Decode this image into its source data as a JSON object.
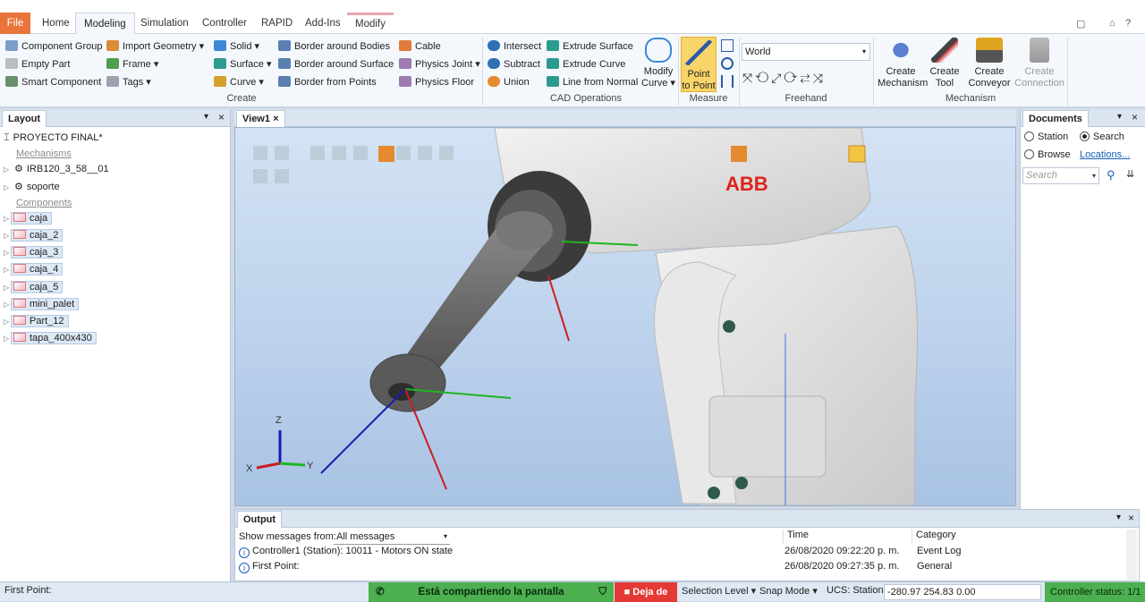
{
  "tabs": [
    "File",
    "Home",
    "Modeling",
    "Simulation",
    "Controller",
    "RAPID",
    "Add-Ins",
    "Modify"
  ],
  "ribbon": {
    "create": [
      "Component Group",
      "Empty Part",
      "Smart Component",
      "Import Geometry",
      "Frame",
      "Tags",
      "Solid",
      "Surface",
      "Curve",
      "Border around Bodies",
      "Border around Surface",
      "Border from Points",
      "Cable",
      "Physics Joint",
      "Physics Floor"
    ],
    "create_label": "Create",
    "cad": [
      "Intersect",
      "Subtract",
      "Union",
      "Extrude Surface",
      "Extrude Curve",
      "Line from Normal"
    ],
    "modify_curve": [
      "Modify",
      "Curve"
    ],
    "cad_label": "CAD Operations",
    "point_to_point": [
      "Point",
      "to Point"
    ],
    "measure_label": "Measure",
    "world": "World",
    "freehand_label": "Freehand",
    "mech": [
      [
        "Create",
        "Mechanism"
      ],
      [
        "Create",
        "Tool"
      ],
      [
        "Create",
        "Conveyor"
      ],
      [
        "Create",
        "Connection"
      ]
    ],
    "mech_label": "Mechanism"
  },
  "layout": {
    "title": "Layout",
    "station": "PROYECTO FINAL*",
    "mech_header": "Mechanisms",
    "mechanisms": [
      "IRB120_3_58__01",
      "soporte"
    ],
    "comp_header": "Components",
    "components": [
      "caja",
      "caja_2",
      "caja_3",
      "caja_4",
      "caja_5",
      "mini_palet",
      "Part_12",
      "tapa_400x430"
    ]
  },
  "view": {
    "tab": "View1",
    "logo": "ABB",
    "axes": [
      "Z",
      "X",
      "Y"
    ]
  },
  "documents": {
    "title": "Documents",
    "station": "Station",
    "search": "Search",
    "browse": "Browse",
    "locations": "Locations...",
    "placeholder": "Search"
  },
  "output": {
    "title": "Output",
    "filter_label": "Show messages from:",
    "filter_value": "All messages",
    "cols": [
      "Time",
      "Category"
    ],
    "rows": [
      {
        "msg": "Controller1 (Station): 10011 - Motors ON state",
        "time": "26/08/2020 09:22:20 p. m.",
        "cat": "Event Log"
      },
      {
        "msg": "First Point:",
        "time": "26/08/2020 09:27:35 p. m.",
        "cat": "General"
      }
    ]
  },
  "status": {
    "left": "First Point:",
    "sharing": "Está compartiendo la pantalla",
    "stop": "Deja de",
    "selection": "Selection Level",
    "snap": "Snap Mode",
    "ucs": "UCS: Station",
    "coords": "-280.97  254.83  0.00",
    "controller": "Controller status: 1/1"
  },
  "colors": {
    "accent": "#e8743b",
    "status_green": "#4caf50",
    "stop_red": "#e53935"
  }
}
